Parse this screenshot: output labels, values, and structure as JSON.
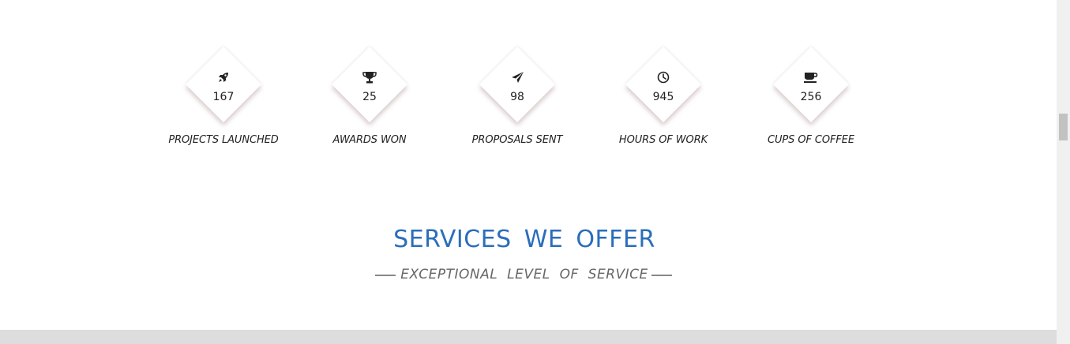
{
  "stats": [
    {
      "icon": "rocket-icon",
      "value": "167",
      "label": "PROJECTS LAUNCHED"
    },
    {
      "icon": "trophy-icon",
      "value": "25",
      "label": "AWARDS WON"
    },
    {
      "icon": "paper-plane-icon",
      "value": "98",
      "label": "PROPOSALS SENT"
    },
    {
      "icon": "clock-icon",
      "value": "945",
      "label": "HOURS OF WORK"
    },
    {
      "icon": "coffee-icon",
      "value": "256",
      "label": "CUPS OF COFFEE"
    }
  ],
  "services": {
    "title": "SERVICES WE OFFER",
    "subtitle": "EXCEPTIONAL LEVEL OF SERVICE"
  },
  "colors": {
    "accent": "#2a6ebb",
    "text": "#222222",
    "subtitle": "#666666",
    "band": "#dddddd"
  }
}
